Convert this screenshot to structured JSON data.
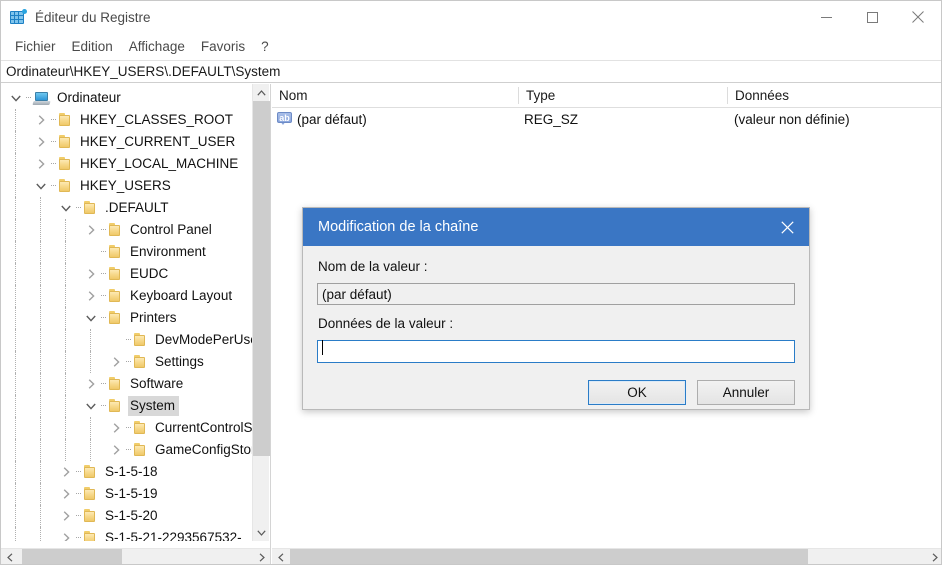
{
  "window": {
    "title": "Éditeur du Registre",
    "app_icon": "registry-grid-icon",
    "controls": {
      "minimize": "minimize-icon",
      "maximize": "maximize-icon",
      "close": "close-icon"
    }
  },
  "menubar": {
    "items": [
      {
        "label": "Fichier"
      },
      {
        "label": "Edition"
      },
      {
        "label": "Affichage"
      },
      {
        "label": "Favoris"
      },
      {
        "label": "?"
      }
    ]
  },
  "address": {
    "path": "Ordinateur\\HKEY_USERS\\.DEFAULT\\System"
  },
  "tree": {
    "items": [
      {
        "label": "Ordinateur",
        "depth": 0,
        "twisty": "expanded",
        "icon": "computer-icon"
      },
      {
        "label": "HKEY_CLASSES_ROOT",
        "depth": 1,
        "twisty": "collapsed",
        "icon": "folder-icon"
      },
      {
        "label": "HKEY_CURRENT_USER",
        "depth": 1,
        "twisty": "collapsed",
        "icon": "folder-icon"
      },
      {
        "label": "HKEY_LOCAL_MACHINE",
        "depth": 1,
        "twisty": "collapsed",
        "icon": "folder-icon"
      },
      {
        "label": "HKEY_USERS",
        "depth": 1,
        "twisty": "expanded",
        "icon": "folder-icon"
      },
      {
        "label": ".DEFAULT",
        "depth": 2,
        "twisty": "expanded",
        "icon": "folder-icon"
      },
      {
        "label": "Control Panel",
        "depth": 3,
        "twisty": "collapsed",
        "icon": "folder-icon"
      },
      {
        "label": "Environment",
        "depth": 3,
        "twisty": "leaf",
        "icon": "folder-icon"
      },
      {
        "label": "EUDC",
        "depth": 3,
        "twisty": "collapsed",
        "icon": "folder-icon"
      },
      {
        "label": "Keyboard Layout",
        "depth": 3,
        "twisty": "collapsed",
        "icon": "folder-icon"
      },
      {
        "label": "Printers",
        "depth": 3,
        "twisty": "expanded",
        "icon": "folder-icon"
      },
      {
        "label": "DevModePerUser",
        "depth": 4,
        "twisty": "leaf",
        "icon": "folder-icon"
      },
      {
        "label": "Settings",
        "depth": 4,
        "twisty": "collapsed",
        "icon": "folder-icon"
      },
      {
        "label": "Software",
        "depth": 3,
        "twisty": "collapsed",
        "icon": "folder-icon"
      },
      {
        "label": "System",
        "depth": 3,
        "twisty": "expanded",
        "icon": "folder-icon",
        "selected": true
      },
      {
        "label": "CurrentControlSet",
        "depth": 4,
        "twisty": "collapsed",
        "icon": "folder-icon"
      },
      {
        "label": "GameConfigStore",
        "depth": 4,
        "twisty": "collapsed",
        "icon": "folder-icon"
      },
      {
        "label": "S-1-5-18",
        "depth": 2,
        "twisty": "collapsed",
        "icon": "folder-icon"
      },
      {
        "label": "S-1-5-19",
        "depth": 2,
        "twisty": "collapsed",
        "icon": "folder-icon"
      },
      {
        "label": "S-1-5-20",
        "depth": 2,
        "twisty": "collapsed",
        "icon": "folder-icon"
      },
      {
        "label": "S-1-5-21-2293567532-",
        "depth": 2,
        "twisty": "collapsed",
        "icon": "folder-icon"
      }
    ]
  },
  "list": {
    "columns": [
      {
        "label": "Nom"
      },
      {
        "label": "Type"
      },
      {
        "label": "Données"
      }
    ],
    "rows": [
      {
        "icon": "string-value-icon",
        "name": "(par défaut)",
        "type": "REG_SZ",
        "data": "(valeur non définie)"
      }
    ]
  },
  "dialog": {
    "title": "Modification de la chaîne",
    "close_icon": "close-icon",
    "name_label": "Nom de la valeur :",
    "name_value": "(par défaut)",
    "data_label": "Données de la valeur :",
    "data_value": "",
    "ok_label": "OK",
    "cancel_label": "Annuler"
  },
  "colors": {
    "dialog_titlebar": "#3a76c4",
    "focus_border": "#2a7cc7",
    "selection": "#d8d8d8",
    "folder": "#f7d98c",
    "scrollbar_thumb": "#cdcdcd"
  }
}
